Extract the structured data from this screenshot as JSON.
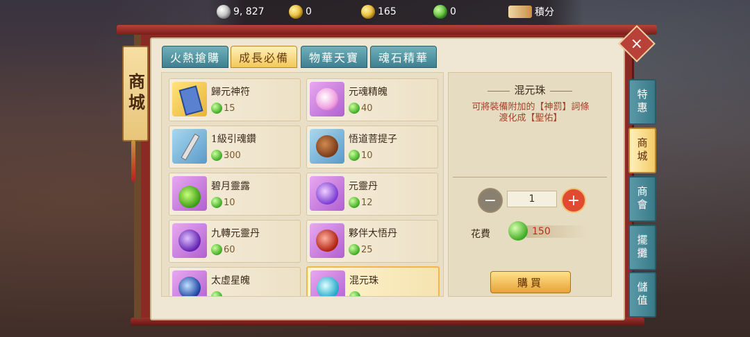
{
  "currencies": [
    {
      "icon": "silver-coin-icon",
      "value": "9, 827"
    },
    {
      "icon": "gold-coin-icon",
      "value": "0"
    },
    {
      "icon": "gold-ingot-icon",
      "value": "165"
    },
    {
      "icon": "jade-coin-icon",
      "value": "0"
    },
    {
      "icon": "points-ticket-icon",
      "value": "積分"
    }
  ],
  "shop": {
    "banner_title": "商城",
    "close_label": "×"
  },
  "tabs": [
    {
      "label": "火熱搶購",
      "active": false
    },
    {
      "label": "成長必備",
      "active": true
    },
    {
      "label": "物華天寶",
      "active": false
    },
    {
      "label": "魂石精華",
      "active": false
    }
  ],
  "items": [
    {
      "name": "歸元神符",
      "price": "15",
      "icon": "talisman-scroll-icon"
    },
    {
      "name": "元魂精魄",
      "price": "40",
      "icon": "soul-orb-icon"
    },
    {
      "name": "1級引魂鑽",
      "price": "300",
      "icon": "soul-drill-icon"
    },
    {
      "name": "悟道菩提子",
      "price": "10",
      "icon": "bodhi-seed-icon"
    },
    {
      "name": "碧月靈露",
      "price": "10",
      "icon": "green-potion-icon"
    },
    {
      "name": "元靈丹",
      "price": "12",
      "icon": "purple-pill-icon"
    },
    {
      "name": "九轉元靈丹",
      "price": "60",
      "icon": "violet-pill-icon"
    },
    {
      "name": "夥伴大悟丹",
      "price": "25",
      "icon": "red-pill-icon"
    },
    {
      "name": "太虛星魄",
      "price": "",
      "icon": "star-orb-icon"
    },
    {
      "name": "混元珠",
      "price": "",
      "icon": "cyan-pearl-icon"
    }
  ],
  "detail": {
    "title": "混元珠",
    "description": "可將裝備附加的【神罰】詞條渡化成【聖佑】",
    "quantity": "1",
    "cost_label": "花費",
    "cost_value": "150",
    "buy_label": "購買"
  },
  "side_tabs": [
    {
      "label": "特惠",
      "active": false
    },
    {
      "label": "商城",
      "active": true
    },
    {
      "label": "商會",
      "active": false
    },
    {
      "label": "擺攤",
      "active": false
    },
    {
      "label": "儲值",
      "active": false
    }
  ],
  "colors": {
    "frame_red": "#8b2a24",
    "tab_teal": "#3e8090",
    "tab_active_gold": "#f2c95a",
    "price_red": "#c02a1a"
  }
}
